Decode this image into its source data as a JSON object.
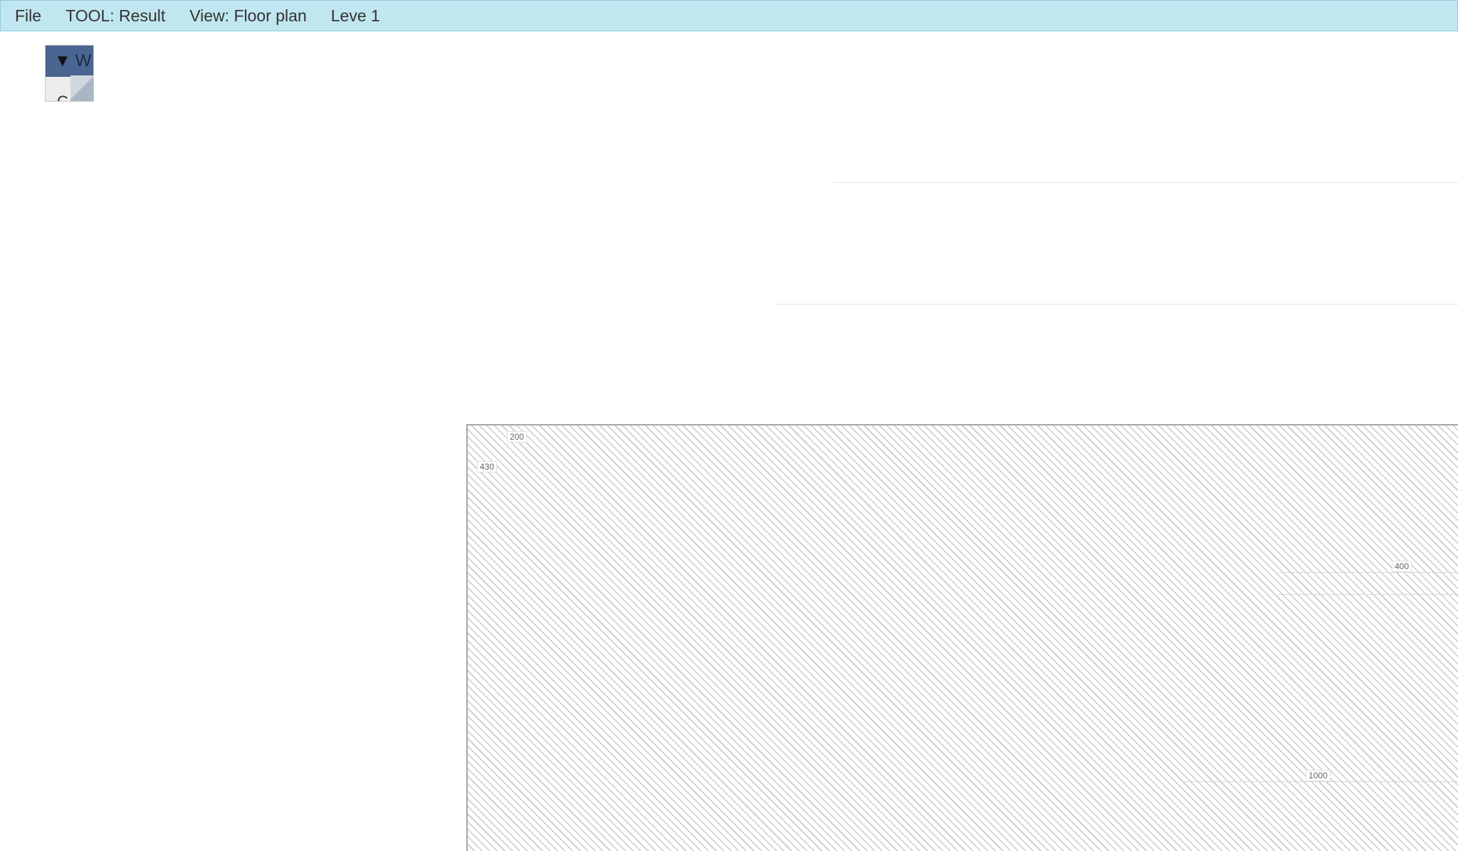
{
  "menubar": {
    "items": [
      "File",
      "TOOL: Result",
      "View: Floor plan",
      "Leve 1"
    ]
  },
  "panel": {
    "arrow": "▼",
    "title": "W",
    "row_label": "C"
  },
  "floor_plan": {
    "dimensions": {
      "top_left_h": "200",
      "top_left_v": "430",
      "right_mid": "400",
      "bottom_right": "1000"
    }
  },
  "colors": {
    "menubar_bg": "#c0e6ef",
    "panel_header": "#4a6591",
    "hatch": "#c9c9c9"
  },
  "icons": {
    "panel_toggle": "triangle-down-icon",
    "panel_resize": "resize-handle-icon"
  }
}
